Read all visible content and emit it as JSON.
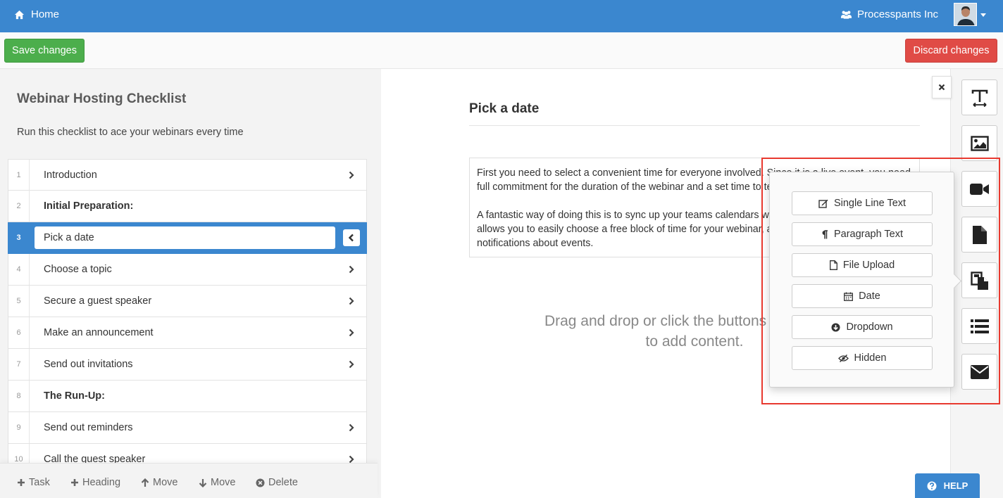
{
  "nav": {
    "home_label": "Home",
    "organization": "Processpants Inc"
  },
  "actions": {
    "save_label": "Save changes",
    "discard_label": "Discard changes"
  },
  "checklist": {
    "title": "Webinar Hosting Checklist",
    "description": "Run this checklist to ace your webinars every time",
    "tasks": [
      {
        "number": "1",
        "label": "Introduction",
        "type": "task"
      },
      {
        "number": "2",
        "label": "Initial Preparation:",
        "type": "heading"
      },
      {
        "number": "3",
        "label": "Pick a date",
        "type": "task",
        "active": true
      },
      {
        "number": "4",
        "label": "Choose a topic",
        "type": "task"
      },
      {
        "number": "5",
        "label": "Secure a guest speaker",
        "type": "task"
      },
      {
        "number": "6",
        "label": "Make an announcement",
        "type": "task"
      },
      {
        "number": "7",
        "label": "Send out invitations",
        "type": "task"
      },
      {
        "number": "8",
        "label": "The Run-Up:",
        "type": "heading"
      },
      {
        "number": "9",
        "label": "Send out reminders",
        "type": "task"
      },
      {
        "number": "10",
        "label": "Call the guest speaker",
        "type": "task"
      }
    ]
  },
  "bottom_toolbar": {
    "task": "Task",
    "heading": "Heading",
    "move_up": "Move",
    "move_down": "Move",
    "delete": "Delete"
  },
  "content": {
    "title": "Pick a date",
    "text_lines": [
      "First you need to select a convenient time for everyone involved. Since it is a live event, you need",
      "full commitment for the duration of the webinar and a set time to tell everyone.",
      "A fantastic way of doing this is to sync up your teams calendars with",
      "allows you to easily choose a free block of time for your webinar, and",
      "notifications about events."
    ],
    "dropzone_line1": "Drag and drop or click the buttons on the right",
    "dropzone_line2": "to add content."
  },
  "form_fields_popover": {
    "items": [
      "Single Line Text",
      "Paragraph Text",
      "File Upload",
      "Date",
      "Dropdown",
      "Hidden"
    ]
  },
  "right_toolbar": {
    "tools": [
      "text-icon",
      "image-icon",
      "video-icon",
      "file-icon",
      "form-fields-icon",
      "list-icon",
      "email-icon"
    ]
  },
  "help_label": "HELP",
  "colors": {
    "primary": "#3b87cf",
    "success": "#4cae4c",
    "danger": "#e04b46",
    "highlight": "#e8392f"
  }
}
